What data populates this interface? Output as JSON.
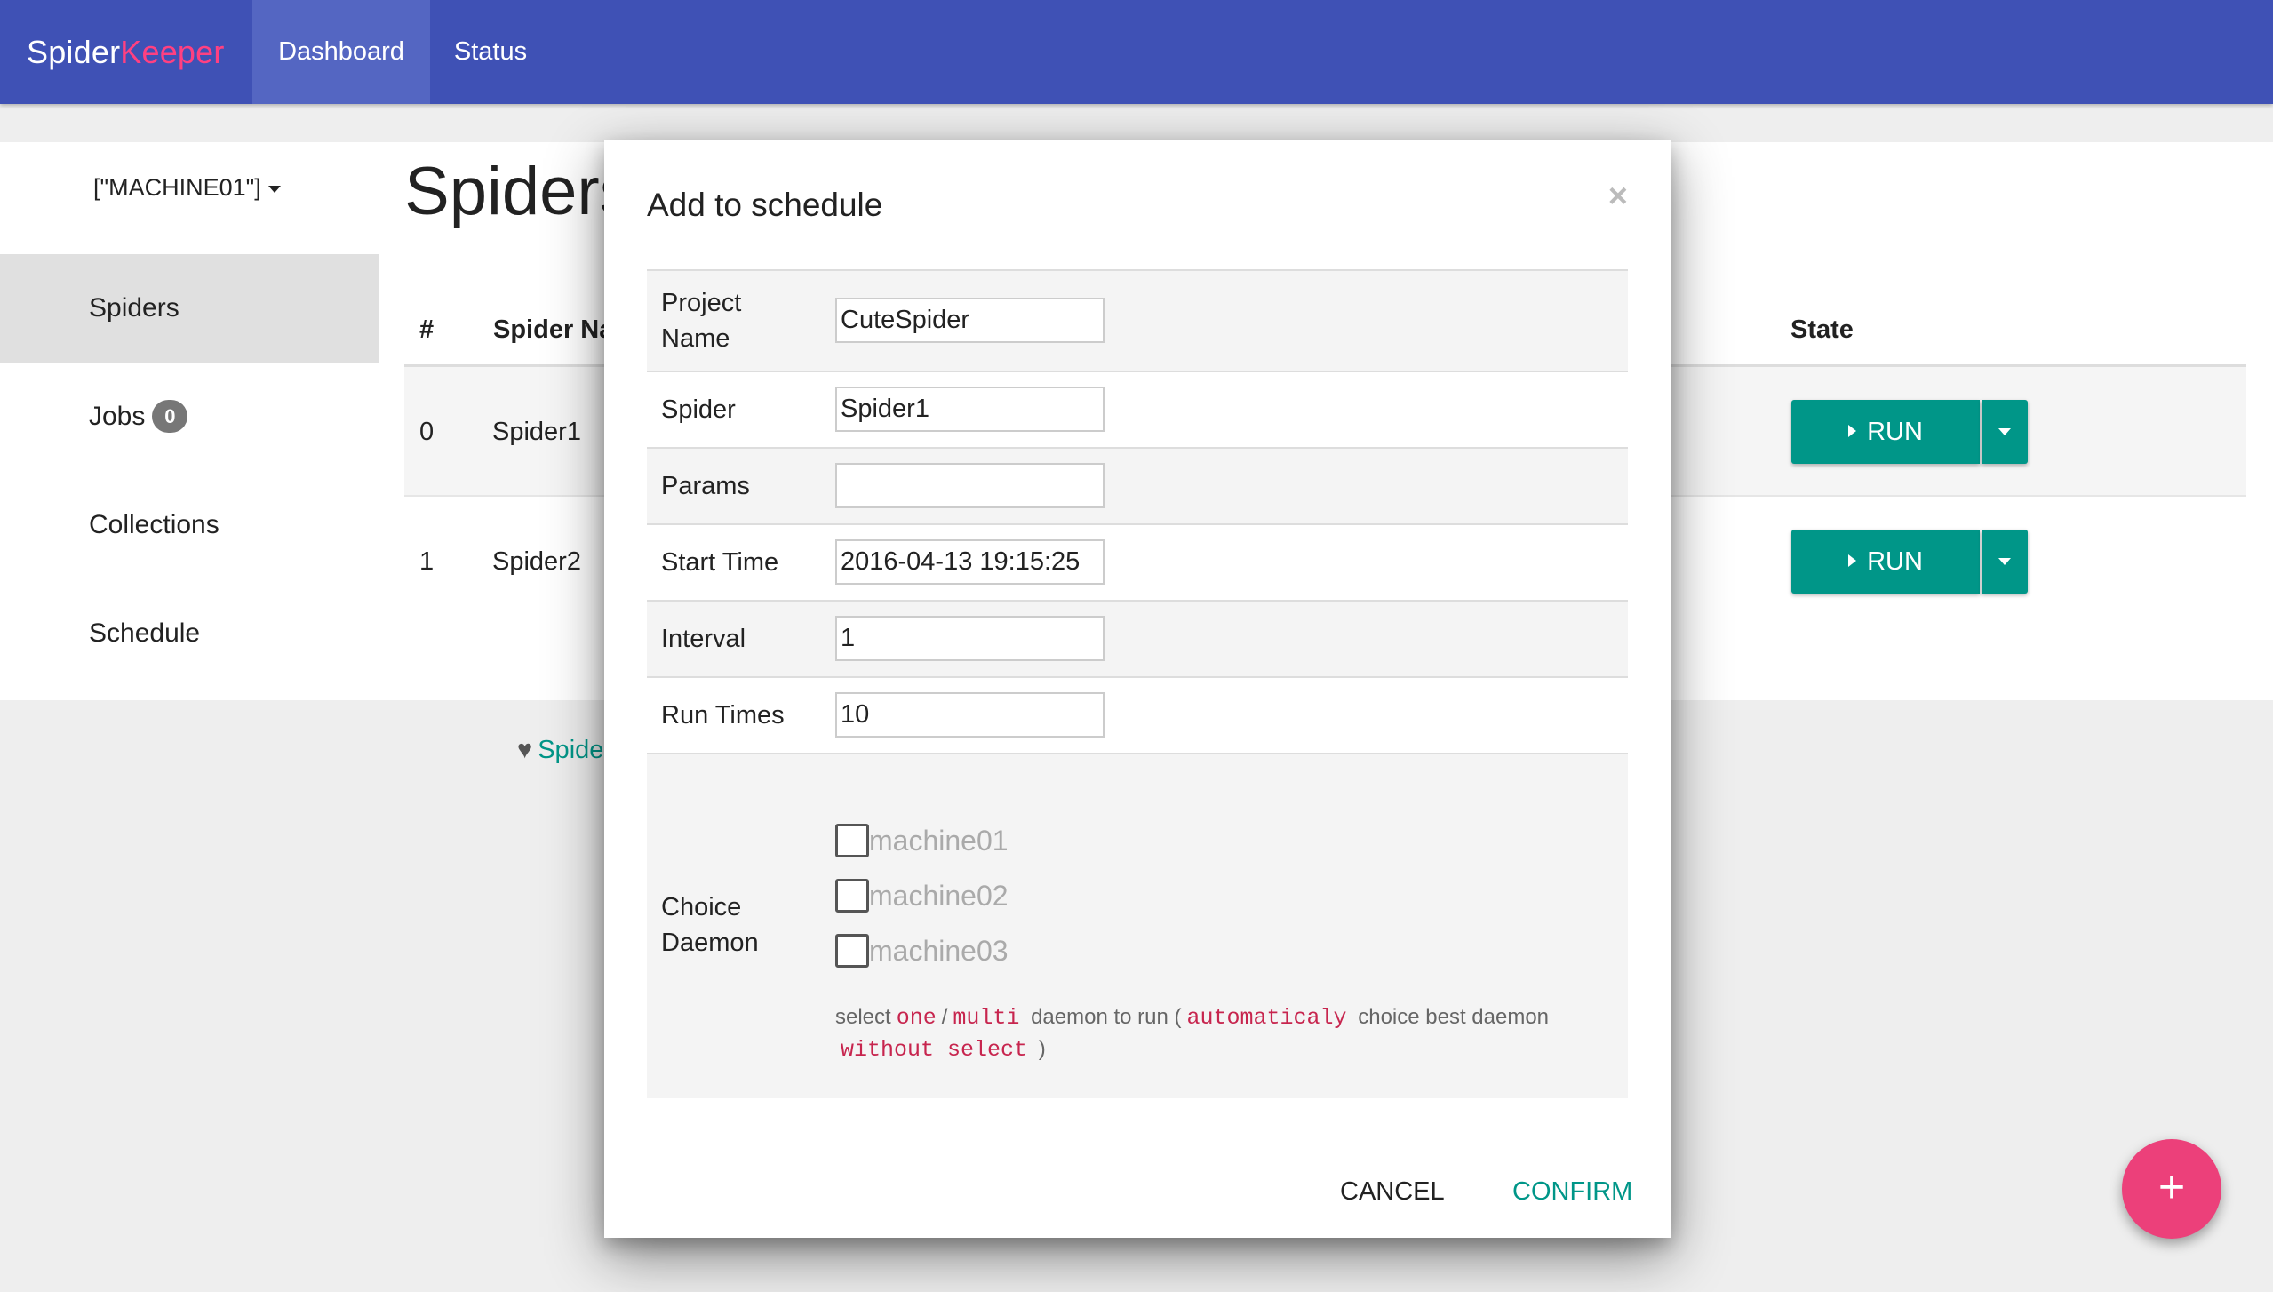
{
  "navbar": {
    "brand_part1": "Spider",
    "brand_part2": "Keeper",
    "items": [
      {
        "label": "Dashboard"
      },
      {
        "label": "Status"
      }
    ]
  },
  "sidebar": {
    "machine_select": "[\"MACHINE01\"]",
    "items": [
      {
        "label": "Spiders"
      },
      {
        "label": "Jobs",
        "badge": "0"
      },
      {
        "label": "Collections"
      },
      {
        "label": "Schedule"
      }
    ]
  },
  "main": {
    "title": "Spiders",
    "columns": [
      "#",
      "Spider Na",
      "State"
    ],
    "rows": [
      {
        "index": "0",
        "name": "Spider1",
        "action": "RUN"
      },
      {
        "index": "1",
        "name": "Spider2",
        "action": "RUN"
      }
    ],
    "footer_link": "Spide"
  },
  "modal": {
    "title": "Add to schedule",
    "close": "×",
    "fields": {
      "project_name": {
        "label_line1": "Project",
        "label_line2": "Name",
        "value": "CuteSpider"
      },
      "spider": {
        "label": "Spider",
        "value": "Spider1"
      },
      "params": {
        "label": "Params",
        "value": ""
      },
      "start_time": {
        "label": "Start Time",
        "value": "2016-04-13 19:15:25"
      },
      "interval": {
        "label": "Interval",
        "value": "1"
      },
      "run_times": {
        "label": "Run Times",
        "value": "10"
      }
    },
    "daemon": {
      "label_line1": "Choice",
      "label_line2": "Daemon",
      "options": [
        "machine01",
        "machine02",
        "machine03"
      ],
      "help": {
        "t1": "select",
        "c1": "one",
        "t2": "/",
        "c2": "multi",
        "t3": "daemon to run (",
        "c3": "automaticaly",
        "t4": "choice best daemon",
        "c4": "without select",
        "t5": ")"
      }
    },
    "cancel_label": "CANCEL",
    "confirm_label": "CONFIRM"
  },
  "fab": {
    "label": "+"
  },
  "colors": {
    "primary": "#3f51b5",
    "accent": "#ff4081",
    "teal": "#009688",
    "fab": "#ec407a"
  }
}
